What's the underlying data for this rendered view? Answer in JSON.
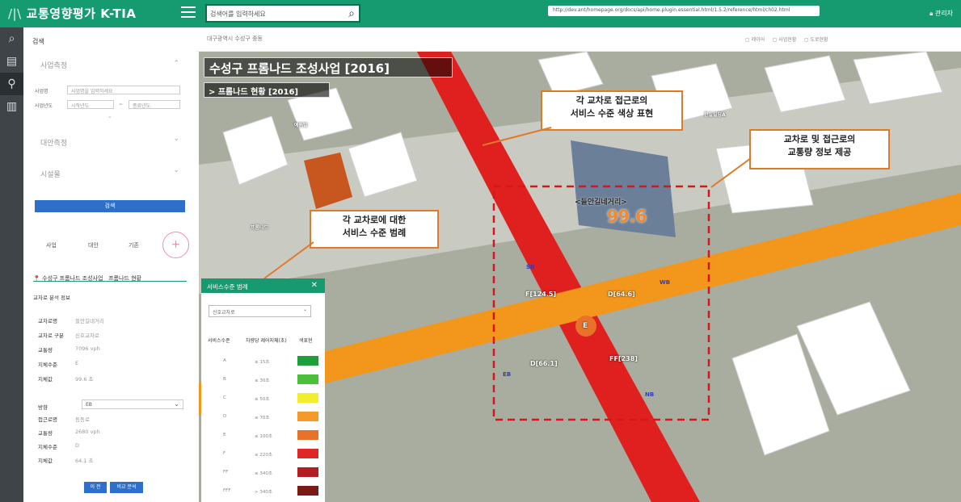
{
  "header": {
    "logo_mark": "/|\\",
    "app_name": "교통영향평가 K-TIA",
    "search_placeholder": "검색어를 입력하세요",
    "url": "http://dev.ant/homepage.org/docs/api/home.plugin.essential.html/1.5.2/reference/html/ch02.html",
    "admin": "관리자"
  },
  "sidebar": {
    "title": "검색",
    "sections": {
      "project_type": "사업측정",
      "mitigation": "대안측정",
      "facility": "시설물"
    },
    "fields": {
      "name_label": "사업명",
      "name_placeholder": "사업명을 입력하세요",
      "year_label": "사업년도",
      "year_from": "시작년도",
      "year_to": "종료년도",
      "dash": "~"
    },
    "search_button": "검색",
    "tabs": [
      "사업",
      "대안",
      "기존"
    ],
    "plus": "+",
    "breadcrumb": {
      "project": "수성구 프롬나드 조성사업",
      "section": "프롬나드 현황"
    },
    "analysis_title": "교차로 분석 정보",
    "info": [
      {
        "k": "교차로명",
        "v": "들안길네거리"
      },
      {
        "k": "교차로 구분",
        "v": "신호교차로"
      },
      {
        "k": "교통량",
        "v": "7096 vph"
      },
      {
        "k": "지체수준",
        "v": "E"
      },
      {
        "k": "지체값",
        "v": "99.6 초"
      }
    ],
    "direction_label": "방향",
    "direction_value": "EB",
    "approach": [
      {
        "k": "접근로명",
        "v": "동동로"
      },
      {
        "k": "교통량",
        "v": "2680 vph"
      },
      {
        "k": "지체수준",
        "v": "D"
      },
      {
        "k": "지체값",
        "v": "64.1 초"
      }
    ],
    "btn_prev": "이 전",
    "btn_compare": "비교 분석"
  },
  "mapheader": {
    "location": "대구광역시 수성구 중동",
    "tools": [
      "레이어",
      "사업현황",
      "도로현황"
    ]
  },
  "map": {
    "title": "수성구 프롬나드 조성사업 [2016]",
    "subtitle": "> 프롬나드 현황 [2016]",
    "intersection": "<들안길네거리>",
    "delay": "99.6",
    "los_center": "E",
    "approach_labels": [
      "F[124.5]",
      "D[64.6]",
      "D[66.1]",
      "FF[238]"
    ],
    "dir_labels": [
      "SB",
      "WB",
      "EB",
      "NB"
    ],
    "building_labels": [
      "예원빌",
      "프롬나드",
      "한일빌딩A"
    ]
  },
  "callouts": {
    "c1": [
      "각 교차로 접근로의",
      "서비스 수준 색상 표현"
    ],
    "c2": [
      "교차로 및 접근로의",
      "교통량 정보 제공"
    ],
    "c3": [
      "각 교차로에 대한",
      "서비스 수준 범례"
    ]
  },
  "legend": {
    "title": "서비스수준 범례",
    "close": "✕",
    "select": "신호교차로",
    "headers": [
      "서비스수준",
      "차량당 제어지체(초)",
      "색표현"
    ],
    "rows": [
      {
        "los": "A",
        "delay": "≤ 15초",
        "color": "#1f9e3c"
      },
      {
        "los": "B",
        "delay": "≤ 30초",
        "color": "#4cbf3a"
      },
      {
        "los": "C",
        "delay": "≤ 50초",
        "color": "#f2ee2d"
      },
      {
        "los": "D",
        "delay": "≤ 70초",
        "color": "#f39a2a"
      },
      {
        "los": "E",
        "delay": "≤ 100초",
        "color": "#e8722a"
      },
      {
        "los": "F",
        "delay": "≤ 220초",
        "color": "#e02626"
      },
      {
        "los": "FF",
        "delay": "≤ 340초",
        "color": "#b41e22"
      },
      {
        "los": "FFF",
        "delay": "> 340초",
        "color": "#7a1a14"
      }
    ]
  }
}
